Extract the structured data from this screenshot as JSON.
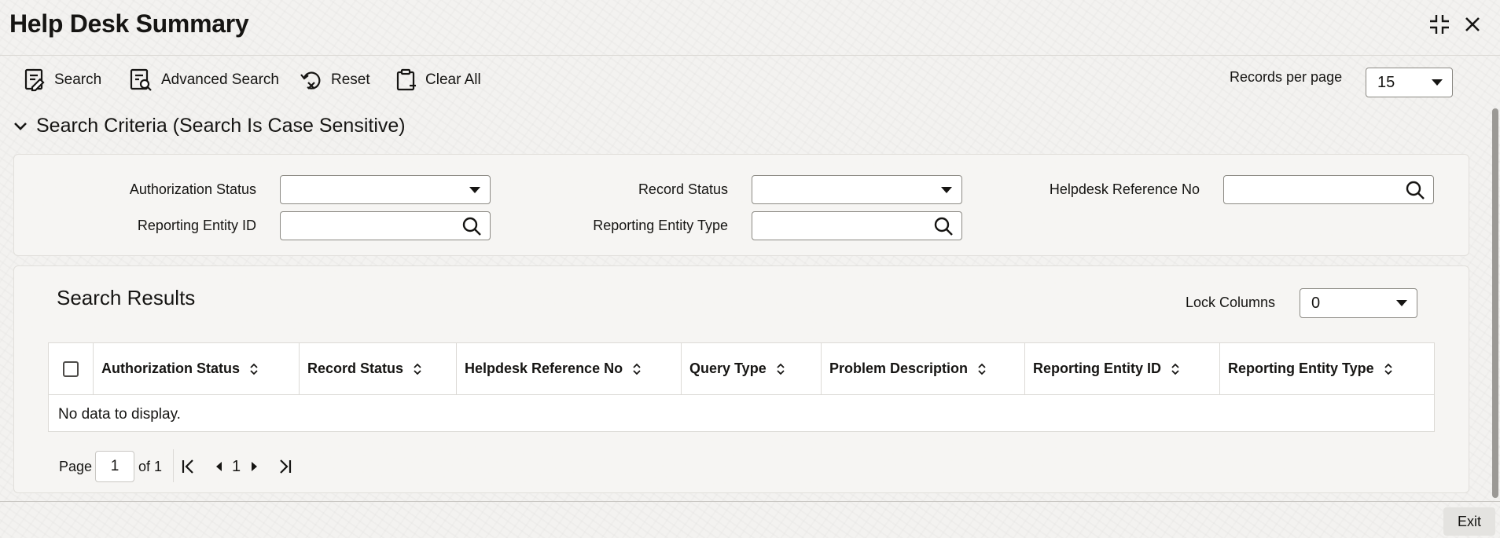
{
  "header": {
    "title": "Help Desk Summary"
  },
  "toolbar": {
    "search_label": "Search",
    "advanced_search_label": "Advanced Search",
    "reset_label": "Reset",
    "clear_all_label": "Clear All",
    "records_per_page_label": "Records per page",
    "records_per_page_value": "15"
  },
  "criteria": {
    "title": "Search Criteria (Search Is Case Sensitive)",
    "authorization_status_label": "Authorization Status",
    "authorization_status_value": "",
    "record_status_label": "Record Status",
    "record_status_value": "",
    "helpdesk_reference_no_label": "Helpdesk Reference No",
    "helpdesk_reference_no_value": "",
    "reporting_entity_id_label": "Reporting Entity ID",
    "reporting_entity_id_value": "",
    "reporting_entity_type_label": "Reporting Entity Type",
    "reporting_entity_type_value": ""
  },
  "results": {
    "title": "Search Results",
    "lock_columns_label": "Lock Columns",
    "lock_columns_value": "0",
    "columns": [
      "Authorization Status",
      "Record Status",
      "Helpdesk Reference No",
      "Query Type",
      "Problem Description",
      "Reporting Entity ID",
      "Reporting Entity Type"
    ],
    "empty_message": "No data to display."
  },
  "pagination": {
    "page_label": "Page",
    "current_page": "1",
    "of_label": "of 1",
    "page_number": "1"
  },
  "footer": {
    "exit_label": "Exit"
  }
}
